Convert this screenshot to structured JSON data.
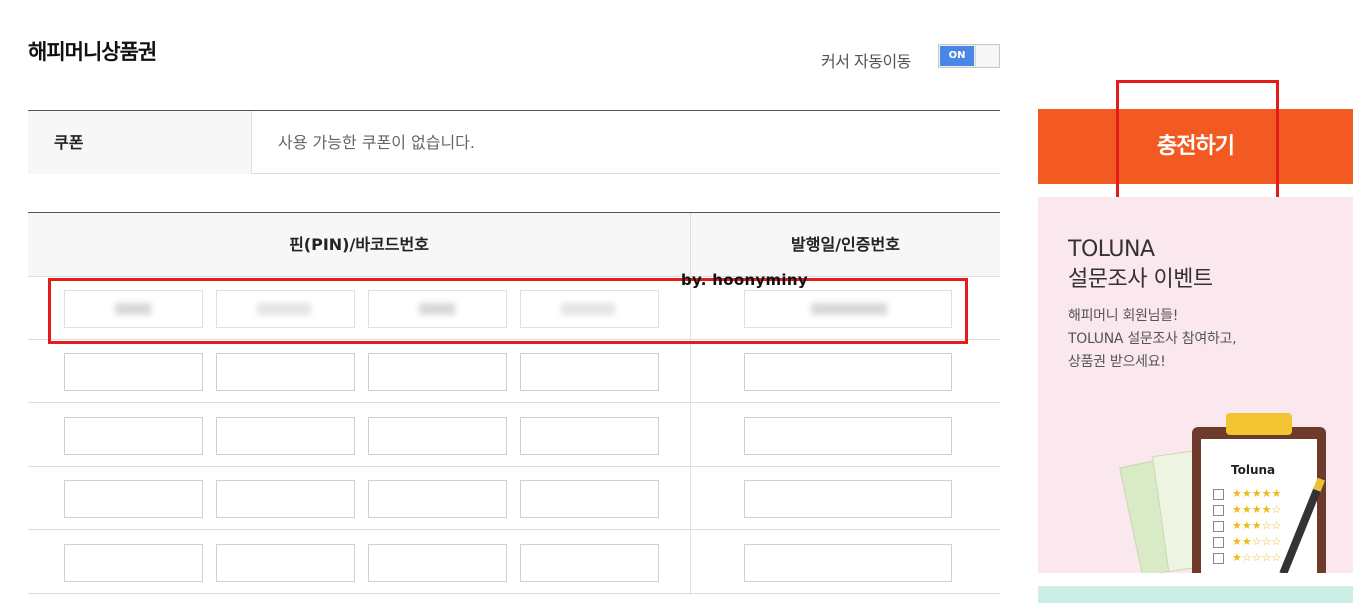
{
  "page": {
    "title": "해피머니상품권",
    "cursor_auto_move": {
      "label": "커서 자동이동",
      "state": "ON"
    }
  },
  "coupon": {
    "header": "쿠폰",
    "message": "사용 가능한 쿠폰이 없습니다."
  },
  "pin_table": {
    "headers": [
      "핀(PIN)/바코드번호",
      "발행일/인증번호"
    ],
    "row_count": 5
  },
  "watermark": "by. hoonyminy",
  "charge_button": {
    "label": "충전하기"
  },
  "banner": {
    "title_line1": "TOLUNA",
    "title_line2": "설문조사 이벤트",
    "desc_line1": "해피머니 회원님들!",
    "desc_line2": "TOLUNA 설문조사 참여하고,",
    "desc_line3": "상품권 받으세요!",
    "logo_text": "Toluna"
  },
  "colors": {
    "accent_orange": "#f25a22",
    "toggle_on_blue": "#4a86e8",
    "highlight_red": "#e41b1b",
    "banner_pink": "#fbe8ee"
  }
}
